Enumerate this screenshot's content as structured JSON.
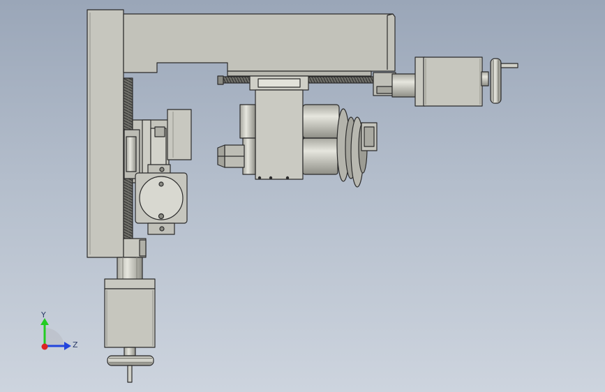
{
  "axes": {
    "y_label": "Y",
    "z_label": "Z",
    "y_color": "#22cc22",
    "z_color": "#2244dd",
    "x_color": "#dd2222"
  },
  "colors": {
    "part_fill": "#c8c8c0",
    "part_fill_light": "#d8d8d0",
    "part_fill_dark": "#9c9c94",
    "outline": "#2b2b2b",
    "background_top": "#9aa6b8",
    "background_bottom": "#cdd4de"
  }
}
